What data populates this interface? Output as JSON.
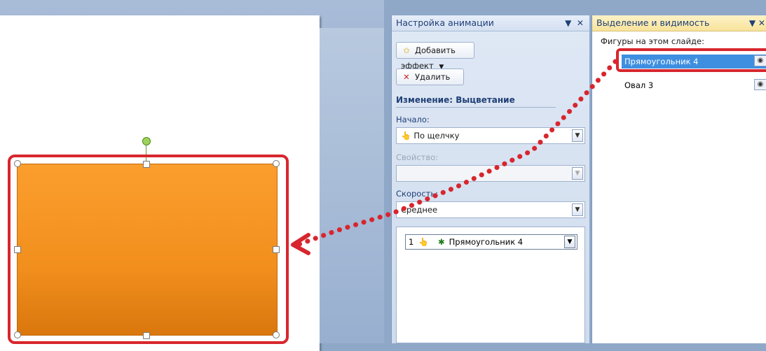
{
  "animation_pane": {
    "title": "Настройка анимации",
    "add_effect_label": "Добавить эффект",
    "remove_label": "Удалить",
    "change_heading": "Изменение: Выцветание",
    "start_label": "Начало:",
    "start_value": "По щелчку",
    "property_label": "Свойство:",
    "property_value": "",
    "speed_label": "Скорость:",
    "speed_value": "Среднее",
    "list_items": [
      {
        "order": "1",
        "name": "Прямоугольник 4"
      }
    ]
  },
  "selection_pane": {
    "title": "Выделение и видимость",
    "subtitle": "Фигуры на этом слайде:",
    "shapes": [
      {
        "name": "Прямоугольник 4",
        "selected": true
      },
      {
        "name": "Овал 3",
        "selected": false
      }
    ]
  },
  "colors": {
    "highlight_red": "#d8262e",
    "shape_orange": "#f28f1d",
    "selection_blue": "#3f8fe0"
  }
}
